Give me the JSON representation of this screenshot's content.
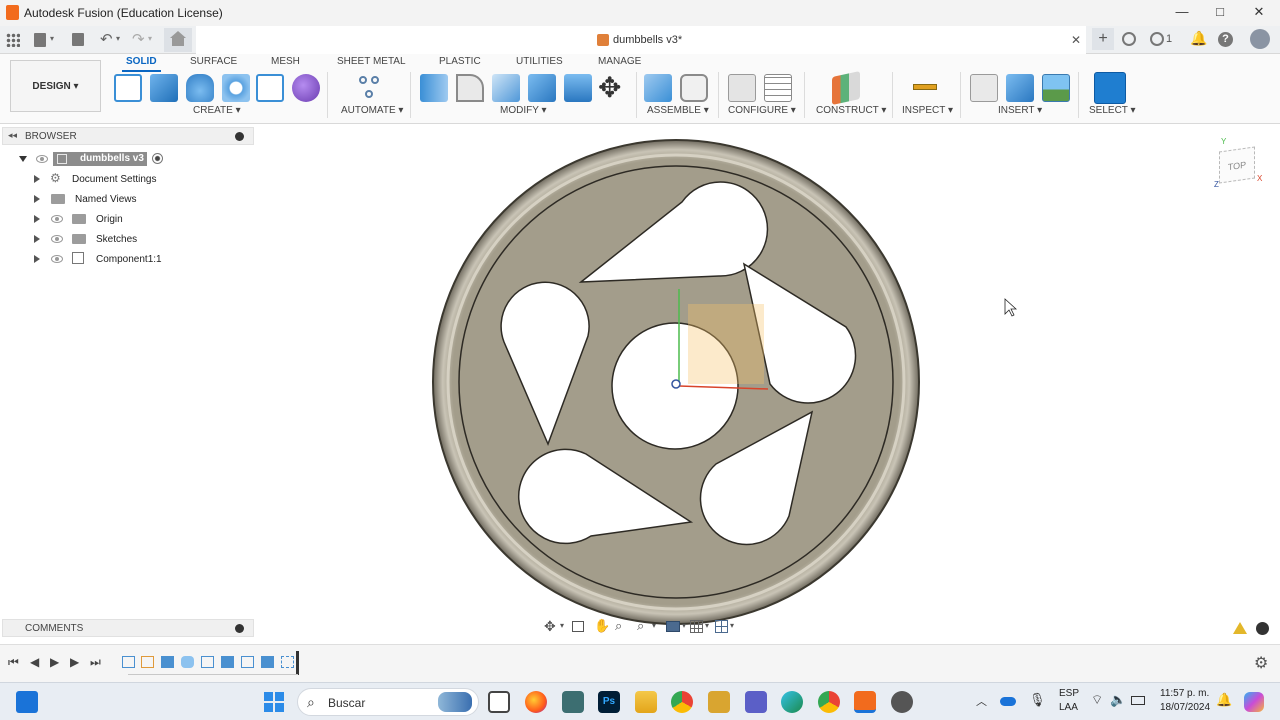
{
  "window": {
    "title": "Autodesk Fusion (Education License)",
    "minimize": "—",
    "maximize": "□",
    "close": "✕"
  },
  "document_tab": {
    "name": "dumbbells v3*",
    "close": "✕",
    "add": "+",
    "notification_count": "1"
  },
  "ribbon": {
    "workspace": "DESIGN ▾",
    "tabs": [
      "SOLID",
      "SURFACE",
      "MESH",
      "SHEET METAL",
      "PLASTIC",
      "UTILITIES",
      "MANAGE"
    ],
    "active_tab": "SOLID",
    "groups": [
      "CREATE ▾",
      "AUTOMATE ▾",
      "MODIFY ▾",
      "ASSEMBLE ▾",
      "CONFIGURE ▾",
      "CONSTRUCT ▾",
      "INSPECT ▾",
      "INSERT ▾",
      "SELECT ▾"
    ]
  },
  "browser": {
    "title": "BROWSER",
    "root": "dumbbells v3",
    "items": [
      "Document Settings",
      "Named Views",
      "Origin",
      "Sketches",
      "Component1:1"
    ]
  },
  "comments": {
    "title": "COMMENTS"
  },
  "viewcube": {
    "face": "TOP",
    "axis_x": "X",
    "axis_y": "Y",
    "axis_z": "Z"
  },
  "taskbar": {
    "search_placeholder": "Buscar",
    "language": "ESP",
    "layout": "LAA",
    "time": "11:57 p. m.",
    "date": "18/07/2024"
  },
  "colors": {
    "accent": "#0a66c2",
    "part_face": "#a39d8b",
    "part_rim": "#8a8577",
    "hole": "#ffffff",
    "fusion_orange": "#f26b1d"
  }
}
